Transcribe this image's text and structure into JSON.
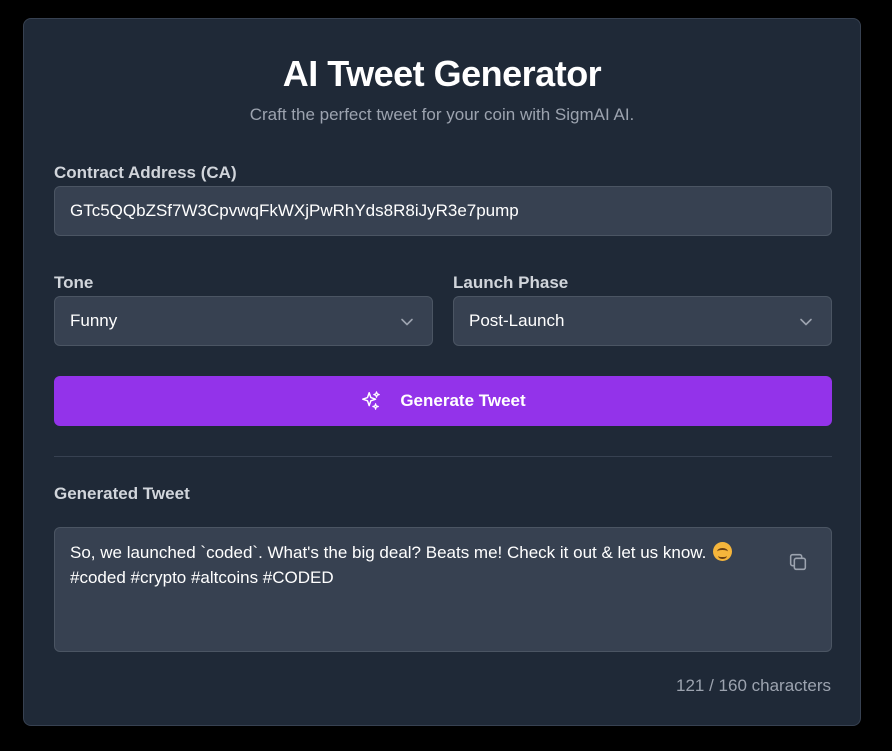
{
  "header": {
    "title": "AI Tweet Generator",
    "subtitle": "Craft the perfect tweet for your coin with SigmAI AI."
  },
  "contract": {
    "label": "Contract Address (CA)",
    "value": "GTc5QQbZSf7W3CpvwqFkWXjPwRhYds8R8iJyR3e7pump"
  },
  "tone": {
    "label": "Tone",
    "selected": "Funny"
  },
  "launch_phase": {
    "label": "Launch Phase",
    "selected": "Post-Launch"
  },
  "generate_button": {
    "label": "Generate Tweet",
    "icon": "sparkles-icon"
  },
  "output": {
    "label": "Generated Tweet",
    "line1": "So, we launched `coded`.  What's the big deal?  Beats me!  Check it out & let us know.",
    "emoji": "smirking-face-icon",
    "line2": "#coded #crypto #altcoins #CODED",
    "copy_icon": "copy-icon"
  },
  "counter": {
    "text": "121 / 160 characters",
    "used": 121,
    "max": 160
  },
  "colors": {
    "background": "#000000",
    "card": "#1f2937",
    "field": "#374151",
    "accent": "#9333ea",
    "muted_text": "#9ca3af",
    "label_text": "#d1d5db"
  }
}
